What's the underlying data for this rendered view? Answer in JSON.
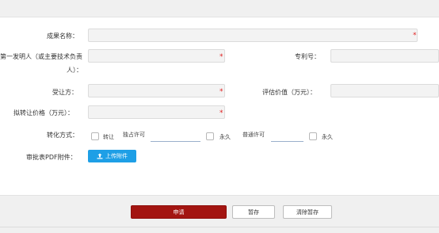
{
  "form": {
    "fields": {
      "result_name": "成果名称：",
      "first_inventor_line1": "第一发明人（或主要技术负责",
      "first_inventor_line2": "人）：",
      "patent_no": "专利号：",
      "assignee": "受让方：",
      "valuation": "评估价值（万元）：",
      "transfer_price": "拟转让价格（万元）：",
      "transfer_mode": "转化方式：",
      "pdf_attachment": "审批表PDF附件："
    },
    "required_mark": "*",
    "transfer_options": {
      "transfer": "转让",
      "exclusive_license": "独占许可",
      "permanent_1": "永久",
      "general_license": "普通许可",
      "permanent_2": "永久"
    },
    "upload_label": "上传附件"
  },
  "actions": {
    "apply": "申请",
    "save_draft": "暂存",
    "clear_draft": "清除暂存"
  },
  "colors": {
    "primary": "#a31511",
    "upload": "#1e9fe6",
    "required": "#e02020"
  }
}
